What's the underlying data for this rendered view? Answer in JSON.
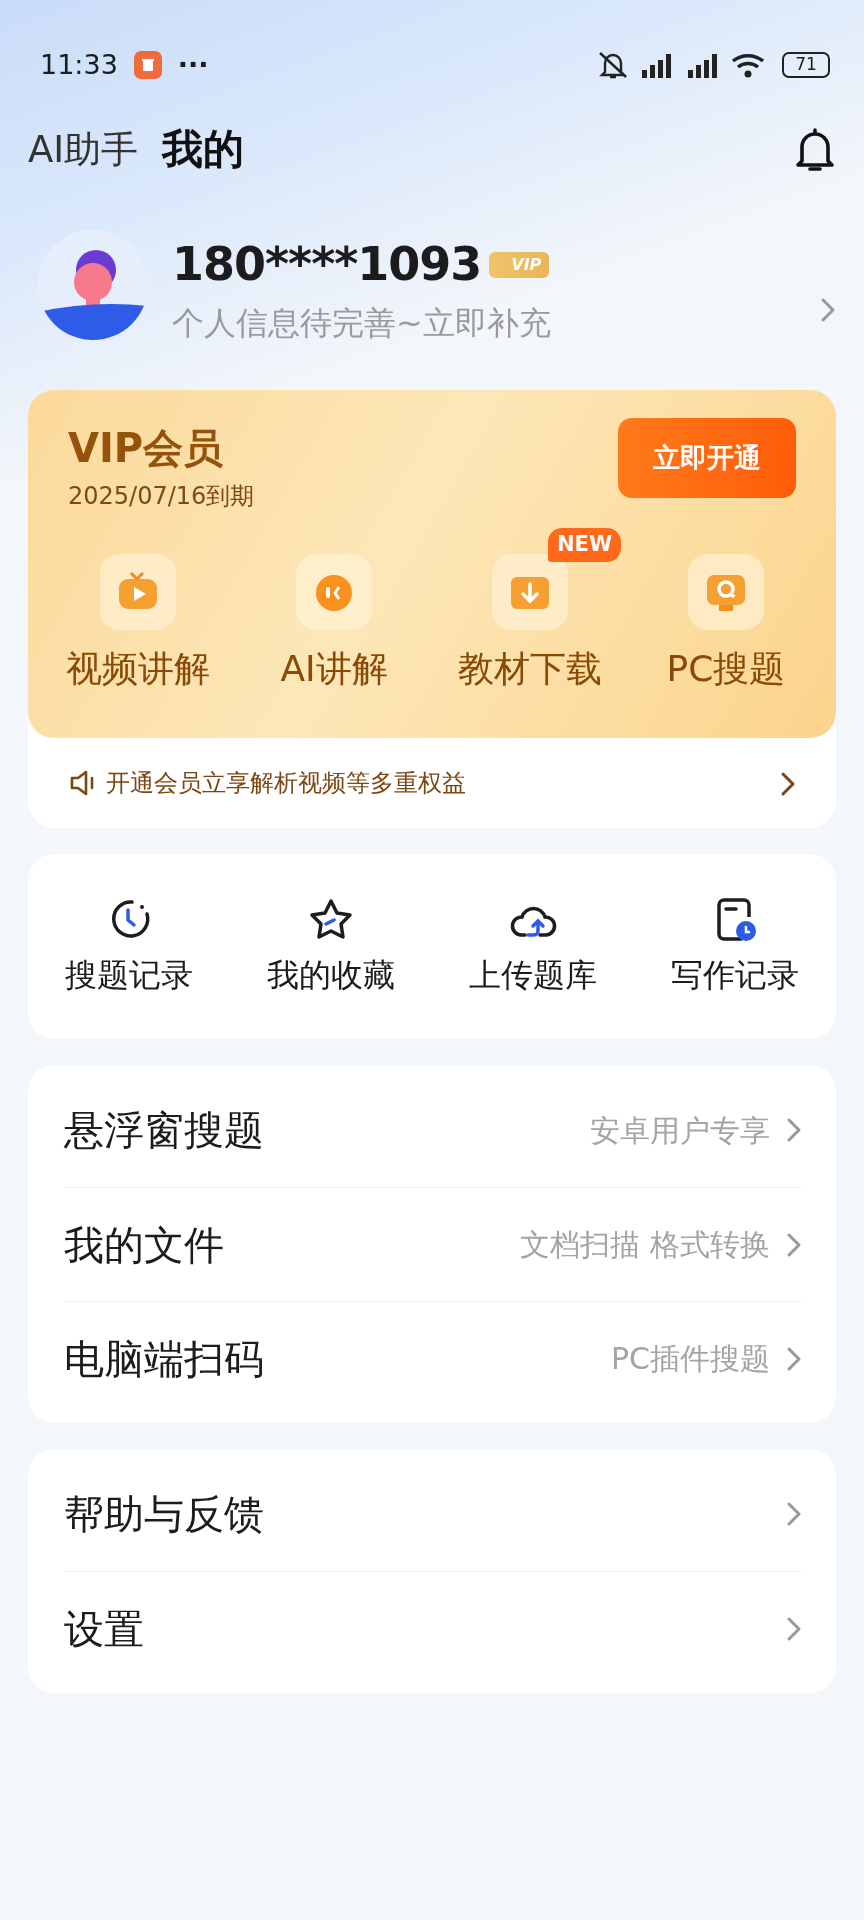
{
  "status_bar": {
    "time": "11:33",
    "more": "···",
    "battery": "71"
  },
  "tabs": [
    {
      "label": "AI助手",
      "selected": false
    },
    {
      "label": "我的",
      "selected": true
    }
  ],
  "profile": {
    "phone": "180****1093",
    "vip_badge": "VIP",
    "subtitle": "个人信息待完善~立即补充"
  },
  "vip_card": {
    "title": "VIP会员",
    "expiry": "2025/07/16到期",
    "button": "立即开通",
    "features": [
      {
        "kind": "video",
        "label": "视频讲解"
      },
      {
        "kind": "ai",
        "label": "AI讲解"
      },
      {
        "kind": "download",
        "label": "教材下载",
        "badge": "NEW"
      },
      {
        "kind": "search",
        "label": "PC搜题"
      }
    ],
    "notice": "开通会员立享解析视频等多重权益"
  },
  "shortcuts": [
    {
      "kind": "history",
      "label": "搜题记录"
    },
    {
      "kind": "star",
      "label": "我的收藏"
    },
    {
      "kind": "upload",
      "label": "上传题库"
    },
    {
      "kind": "writing",
      "label": "写作记录"
    }
  ],
  "menu_groups": [
    [
      {
        "label": "悬浮窗搜题",
        "hint": "安卓用户专享"
      },
      {
        "label": "我的文件",
        "hint": "文档扫描 格式转换"
      },
      {
        "label": "电脑端扫码",
        "hint": "PC插件搜题"
      }
    ],
    [
      {
        "label": "帮助与反馈"
      },
      {
        "label": "设置"
      }
    ]
  ]
}
